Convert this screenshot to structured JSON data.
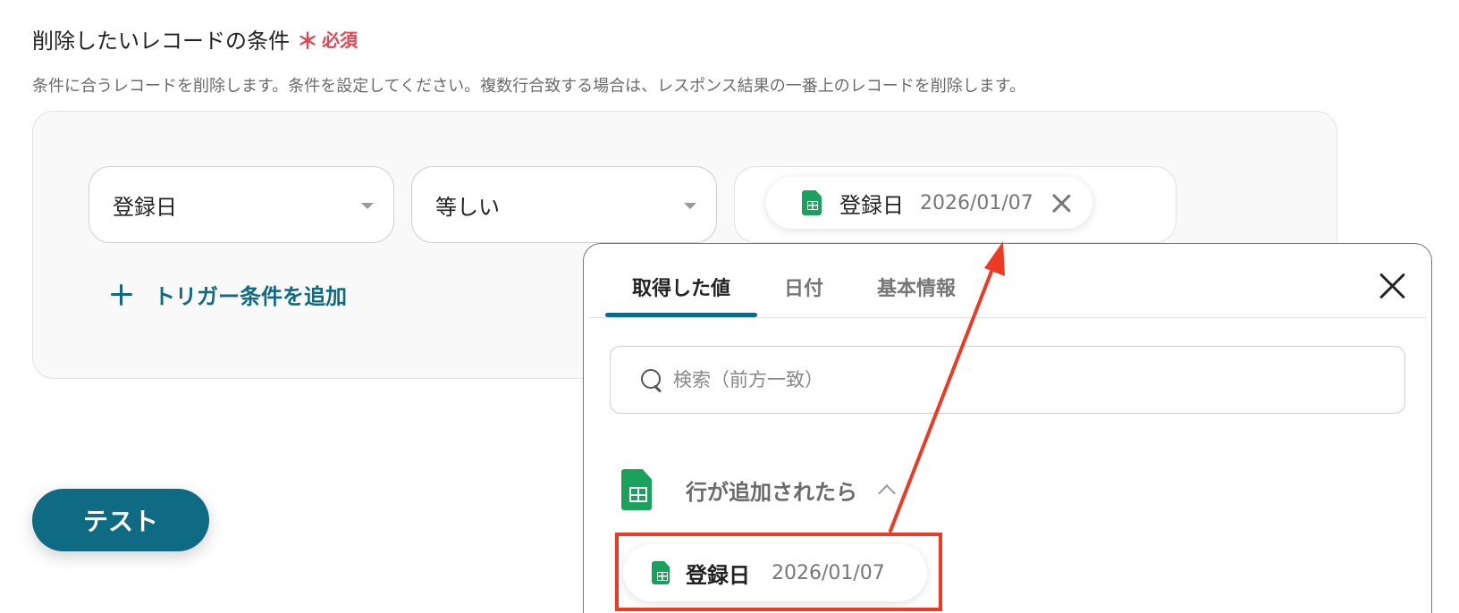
{
  "section": {
    "title": "削除したいレコードの条件",
    "required_mark": "＊",
    "required_label": "必須",
    "description": "条件に合うレコードを削除します。条件を設定してください。複数行合致する場合は、レスポンス結果の一番上のレコードを削除します。"
  },
  "condition": {
    "field": "登録日",
    "operator": "等しい",
    "value_chip": {
      "label": "登録日",
      "value": "2026/01/07",
      "icon": "spreadsheet-icon"
    }
  },
  "add_condition_label": "トリガー条件を追加",
  "test_button_label": "テスト",
  "popup": {
    "tabs": [
      {
        "label": "取得した値",
        "active": true
      },
      {
        "label": "日付",
        "active": false
      },
      {
        "label": "基本情報",
        "active": false
      }
    ],
    "search_placeholder": "検索（前方一致）",
    "group_title": "行が追加されたら",
    "items": [
      {
        "label": "登録日",
        "value": "2026/01/07",
        "icon": "spreadsheet-icon"
      }
    ]
  },
  "colors": {
    "accent": "#0f6b84",
    "required": "#e5434f",
    "annotation": "#ee3a22",
    "sheet_green": "#1aa15c"
  }
}
